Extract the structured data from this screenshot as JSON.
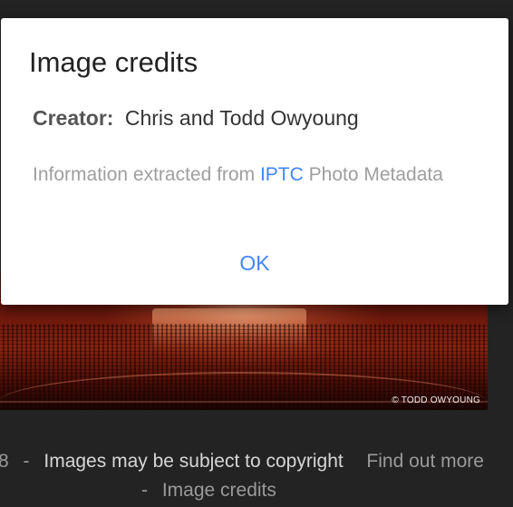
{
  "dialog": {
    "title": "Image credits",
    "creator_label": "Creator:",
    "creator_value": "Chris and Todd Owyoung",
    "info_prefix": "Information extracted from",
    "info_link": "IPTC",
    "info_suffix": "Photo Metadata",
    "ok_label": "OK"
  },
  "photo": {
    "watermark": "© TODD OWYOUNG"
  },
  "footer": {
    "leading_fragment": "8",
    "separator": "-",
    "copyright_text": "Images may be subject to copyright",
    "find_out_more": "Find out more",
    "image_credits": "Image credits"
  },
  "colors": {
    "accent": "#4285f4",
    "dialog_bg": "#ffffff",
    "page_bg": "#232323"
  }
}
